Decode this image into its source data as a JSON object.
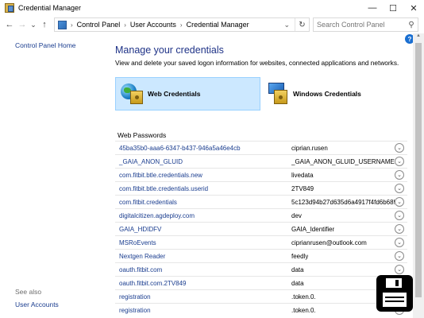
{
  "window": {
    "title": "Credential Manager",
    "controls": {
      "minimize": "—",
      "maximize": "☐",
      "close": "✕"
    }
  },
  "addressbar": {
    "back": "←",
    "forward": "→",
    "recent": "⌄",
    "up": "↑",
    "separator": "›",
    "breadcrumbs": [
      "Control Panel",
      "User Accounts",
      "Credential Manager"
    ],
    "dropdown": "⌄",
    "refresh": "↻",
    "search_placeholder": "Search Control Panel",
    "search_glyph": "⚲"
  },
  "left_pane": {
    "home_link": "Control Panel Home",
    "see_also": "See also",
    "user_accounts_link": "User Accounts"
  },
  "help": "?",
  "main": {
    "title": "Manage your credentials",
    "description": "View and delete your saved logon information for websites, connected applications and networks.",
    "tabs": {
      "web": "Web Credentials",
      "windows": "Windows Credentials"
    },
    "section_header": "Web Passwords",
    "expand_glyph": "⌄",
    "credentials": [
      {
        "name": "45ba35b0-aaa6-6347-b437-946a5a46e4cb",
        "user": "ciprian.rusen"
      },
      {
        "name": "_GAIA_ANON_GLUID",
        "user": "_GAIA_ANON_GLUID_USERNAME"
      },
      {
        "name": "com.fitbit.btle.credentials.new",
        "user": "livedata"
      },
      {
        "name": "com.fitbit.btle.credentials.userid",
        "user": "2TV849"
      },
      {
        "name": "com.fitbit.credentials",
        "user": "5c123d94b27d635d6a4917f4fd6b6858"
      },
      {
        "name": "digitalcitizen.agdeploy.com",
        "user": "dev"
      },
      {
        "name": "GAIA_HDIDFV",
        "user": "GAIA_Identifier"
      },
      {
        "name": "MSRoEvents",
        "user": "ciprianrusen@outlook.com"
      },
      {
        "name": "Nextgen Reader",
        "user": "feedly"
      },
      {
        "name": "oauth.fitbit.com",
        "user": "data"
      },
      {
        "name": "oauth.fitbit.com.2TV849",
        "user": "data"
      },
      {
        "name": "registration",
        "user": ".token.0."
      },
      {
        "name": "registration",
        "user": ".token.0."
      }
    ]
  }
}
